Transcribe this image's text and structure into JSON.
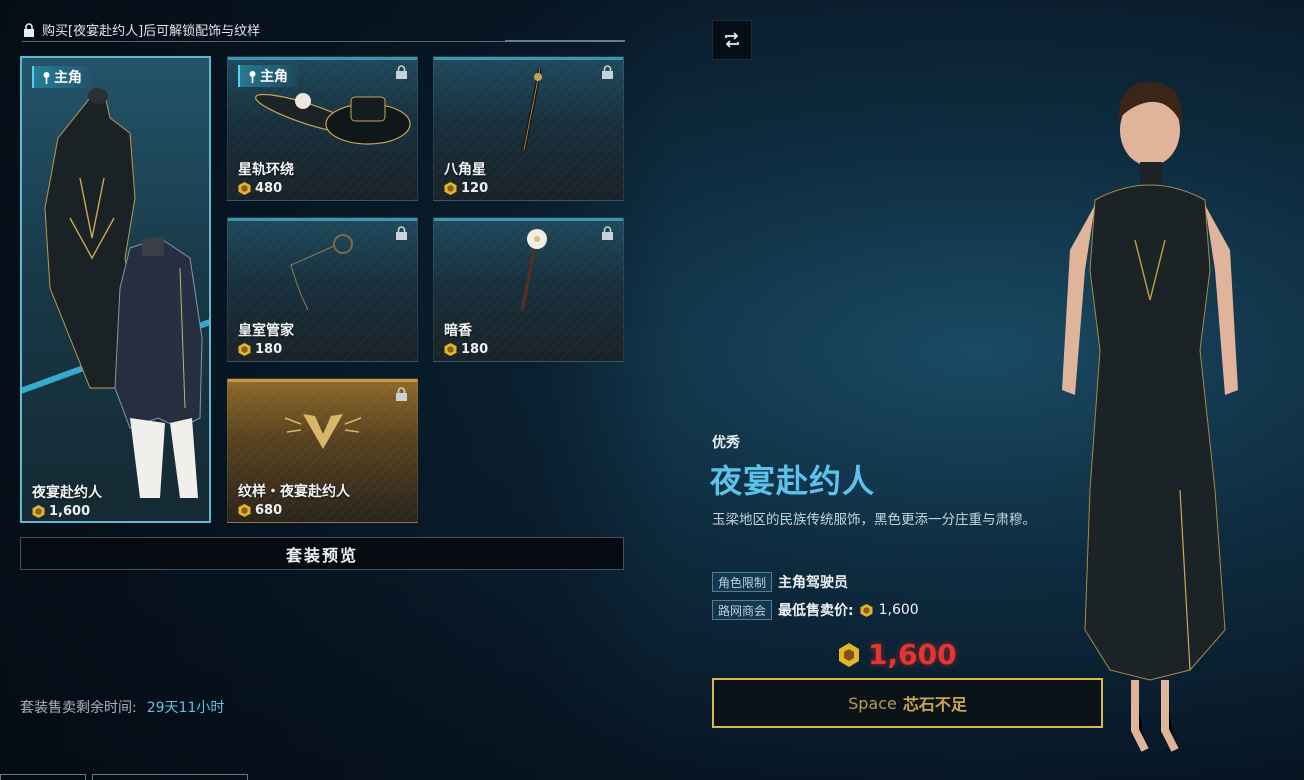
{
  "header": {
    "unlock_text": "购买[夜宴赴约人]后可解锁配饰与纹样"
  },
  "cards": [
    {
      "name": "夜宴赴约人",
      "price": "1,600",
      "tag": "主角",
      "selected": true,
      "locked": false
    },
    {
      "name": "星轨环绕",
      "price": "480",
      "tag": "主角",
      "locked": true
    },
    {
      "name": "八角星",
      "price": "120",
      "locked": true
    },
    {
      "name": "皇室管家",
      "price": "180",
      "locked": true
    },
    {
      "name": "暗香",
      "price": "180",
      "locked": true
    },
    {
      "name": "纹样・夜宴赴约人",
      "price": "680",
      "locked": true,
      "gold": true
    }
  ],
  "suit_preview_label": "套装预览",
  "remaining": {
    "label": "套装售卖剩余时间:",
    "value": "29天11小时"
  },
  "detail": {
    "quality": "优秀",
    "title": "夜宴赴约人",
    "description": "玉梁地区的民族传统服饰，黑色更添一分庄重与肃穆。",
    "attributes": [
      {
        "tag": "角色限制",
        "value": "主角驾驶员"
      },
      {
        "tag": "路网商会",
        "value": "最低售卖价:",
        "price": "1,600"
      }
    ],
    "price": "1,600",
    "buy": {
      "key": "Space",
      "label": "芯石不足"
    }
  },
  "icons": [
    "lock-icon",
    "coin-icon",
    "pin-icon",
    "rotate-icon"
  ],
  "colors": {
    "accent": "#5ec3ea",
    "price_red": "#e8342f",
    "gold_border": "#d8b94a"
  }
}
